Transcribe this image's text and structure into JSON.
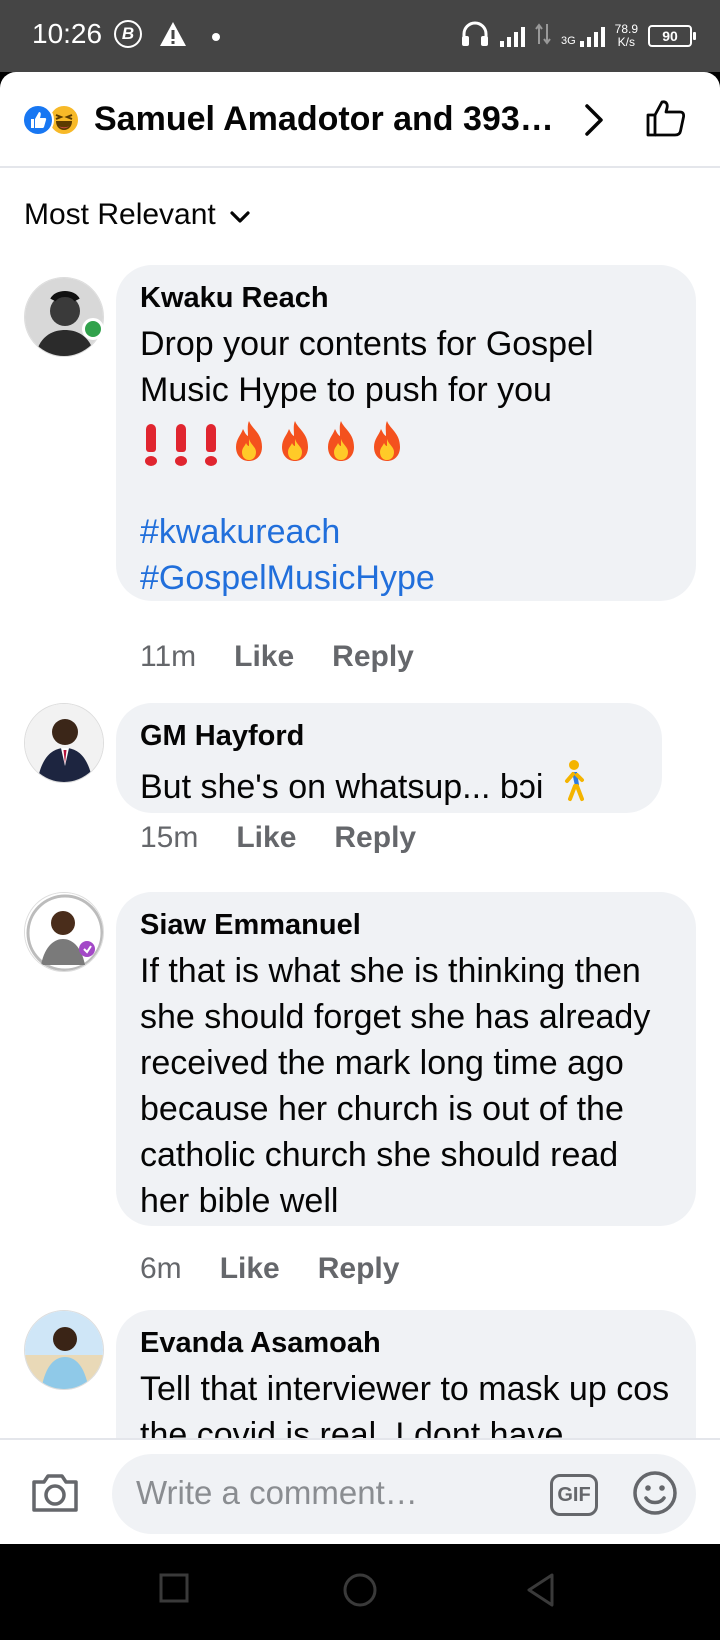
{
  "status_bar": {
    "time": "10:26",
    "b_badge": "B",
    "network_type": "3G",
    "speed_value": "78.9",
    "speed_unit": "K/s",
    "battery": "90"
  },
  "header": {
    "title": "Samuel Amadotor and 393…",
    "reactions": [
      "like-icon",
      "haha-icon"
    ]
  },
  "sort": {
    "label": "Most Relevant"
  },
  "comments": [
    {
      "author": "Kwaku Reach",
      "text": "Drop your contents for Gospel Music Hype to push for you",
      "hashtags": [
        "#kwakureach",
        "#GospelMusicHype"
      ],
      "time": "11m",
      "like": "Like",
      "reply": "Reply"
    },
    {
      "author": "GM Hayford",
      "text": "But she's on whatsup... bɔi",
      "time": "15m",
      "like": "Like",
      "reply": "Reply"
    },
    {
      "author": "Siaw Emmanuel",
      "text": "If that is what she is thinking then she should forget she has already received the mark long time ago because her church is out of the catholic church she should read her bible well",
      "time": "6m",
      "like": "Like",
      "reply": "Reply"
    },
    {
      "author": "Evanda Asamoah",
      "text": "Tell that interviewer to mask up cos the covid is real. I dont have"
    }
  ],
  "composer": {
    "placeholder": "Write a comment…",
    "gif_label": "GIF"
  },
  "colors": {
    "facebook_blue": "#1877f2",
    "hashtag_blue": "#216fdb",
    "bubble_gray": "#f0f2f5",
    "online_green": "#31a24c"
  }
}
